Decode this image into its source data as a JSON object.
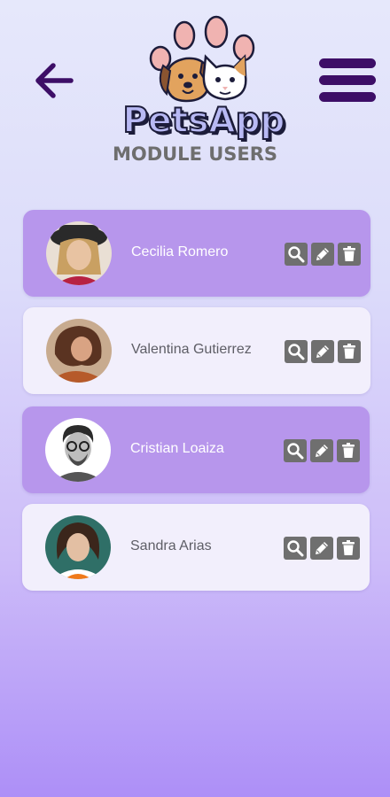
{
  "app": {
    "name": "PetsApp",
    "page_title": "MODULE USERS",
    "colors": {
      "accent": "#3d0e67",
      "card_highlight": "#b796ec",
      "card_light": "#f2effc",
      "action_icon": "#6f6f6f"
    }
  },
  "header": {
    "back_icon": "arrow-left-icon",
    "menu_icon": "hamburger-menu-icon"
  },
  "users": [
    {
      "name": "Cecilia Romero",
      "style": "purple"
    },
    {
      "name": "Valentina Gutierrez",
      "style": "light"
    },
    {
      "name": "Cristian Loaiza",
      "style": "purple"
    },
    {
      "name": "Sandra Arias",
      "style": "light"
    }
  ],
  "row_actions": [
    "search-icon",
    "edit-pencil-icon",
    "delete-trash-icon"
  ]
}
